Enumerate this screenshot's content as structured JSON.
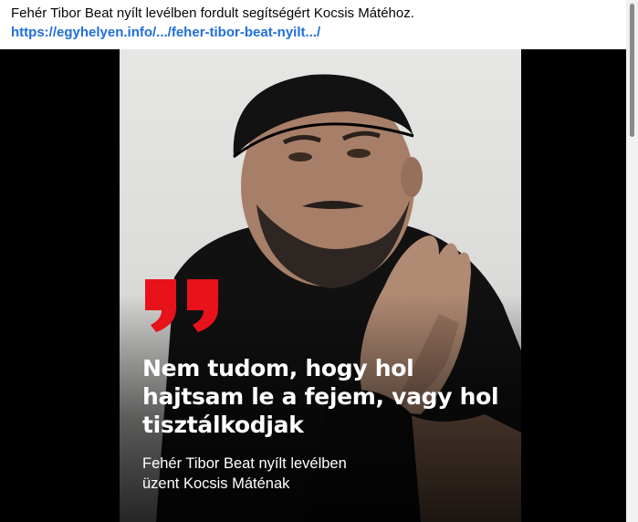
{
  "post": {
    "text": "Fehér Tibor Beat nyílt levélben fordult segítségért Kocsis Mátéhoz.",
    "link": "https://egyhelyen.info/.../feher-tibor-beat-nyilt.../"
  },
  "media": {
    "headline_line1": "Nem tudom, hogy hol",
    "headline_line2": "hajtsam le a fejem, vagy hol",
    "headline_line3": "tisztálkodjak",
    "subline_line1": "Fehér Tibor Beat nyílt levélben",
    "subline_line2": "üzent Kocsis Máténak",
    "quote_color": "#e8121b"
  }
}
